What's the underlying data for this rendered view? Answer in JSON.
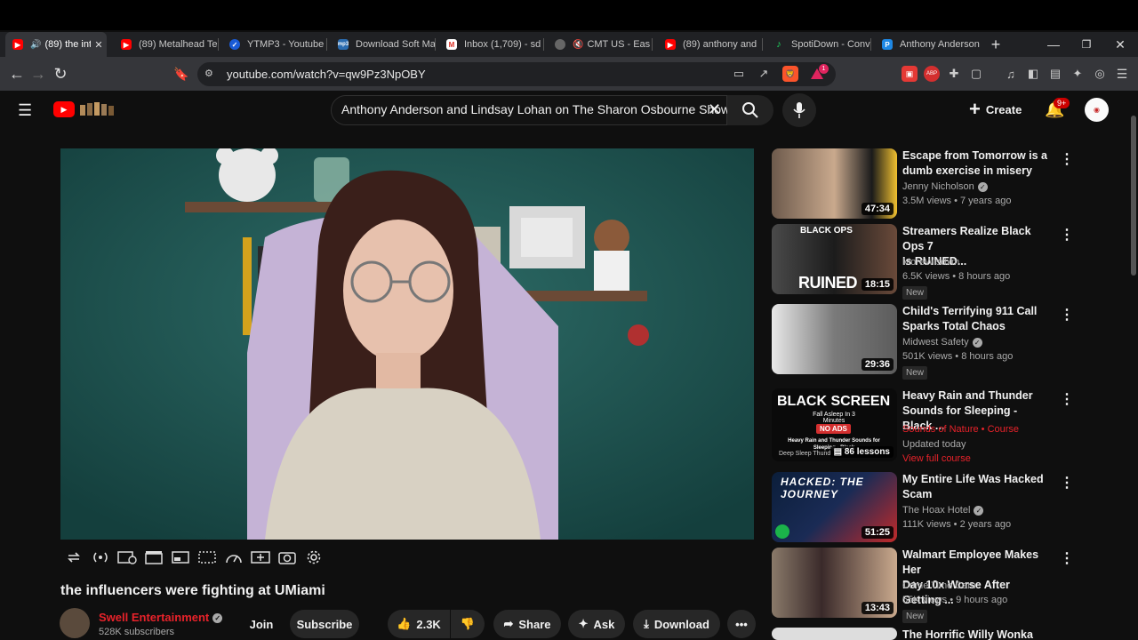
{
  "browser": {
    "tabs": [
      {
        "label": "(89) the int",
        "icon": "youtube-icon",
        "active": true
      },
      {
        "label": "(89) Metalhead Te",
        "icon": "youtube-icon"
      },
      {
        "label": "YTMP3 - Youtube",
        "icon": "ytmp3-icon"
      },
      {
        "label": "Download Soft Ma",
        "icon": "mp3-icon"
      },
      {
        "label": "Inbox (1,709) - sd",
        "icon": "gmail-icon"
      },
      {
        "label": "CMT US - Eas",
        "icon": "globe-icon"
      },
      {
        "label": "(89) anthony and",
        "icon": "youtube-icon"
      },
      {
        "label": "SpotiDown - Conv",
        "icon": "spotidown-icon"
      },
      {
        "label": "Anthony Anderson",
        "icon": "p-icon"
      }
    ],
    "url": "youtube.com/watch?v=qw9Pz3NpOBY",
    "brave_badge": "1"
  },
  "youtube": {
    "search_query": "Anthony Anderson and Lindsay Lohan on The Sharon Osbourne Show",
    "create_label": "Create",
    "notifications_count": "9+",
    "video_title": "the influencers were fighting at UMiami",
    "channel_name": "Swell Entertainment",
    "subscribers": "528K subscribers",
    "join_label": "Join",
    "subscribe_label": "Subscribe",
    "likes": "2.3K",
    "share_label": "Share",
    "ask_label": "Ask",
    "download_label": "Download",
    "colors": {
      "accent": "#ff0000",
      "channel": "#e8222a",
      "background": "#0f0f0f"
    }
  },
  "recommendations": [
    {
      "title_line1": "Escape from Tomorrow is a",
      "title_line2": "dumb exercise in misery",
      "channel": "Jenny Nicholson",
      "verified": true,
      "meta": "3.5M views • 7 years ago",
      "duration": "47:34",
      "badge": ""
    },
    {
      "title_line1": "Streamers Realize Black Ops 7",
      "title_line2": "Is RUINED...",
      "channel": "MoreWisdxm",
      "verified": false,
      "meta": "6.5K views • 8 hours ago",
      "duration": "18:15",
      "badge": "New",
      "thumb_text_top": "BLACK OPS",
      "thumb_text": "RUINED"
    },
    {
      "title_line1": "Child's Terrifying 911 Call",
      "title_line2": "Sparks Total Chaos",
      "channel": "Midwest Safety",
      "verified": true,
      "meta": "501K views • 8 hours ago",
      "duration": "29:36",
      "badge": "New"
    },
    {
      "title_line1": "Heavy Rain and Thunder",
      "title_line2": "Sounds for Sleeping - Black ...",
      "channel": "Sounds of Nature",
      "course": "Course",
      "meta": "Updated today",
      "duration": "86 lessons",
      "link": "View full course",
      "thumb_text": "BLACK SCREEN",
      "thumb_sub": "Fall Asleep In 3 Minutes",
      "thumb_noads": "NO ADS",
      "thumb_desc": "Heavy Rain and Thunder Sounds for Sleeping - Black",
      "thumb_bottom": "Deep Sleep Thund"
    },
    {
      "title_line1": "My Entire Life Was Hacked",
      "title_line2": "Scam",
      "channel": "The Hoax Hotel",
      "verified": true,
      "meta": "111K views • 2 years ago",
      "duration": "51:25",
      "badge": "",
      "thumb_text": "HACKED: THE JOURNEY"
    },
    {
      "title_line1": "Walmart Employee Makes Her",
      "title_line2": "Day 10x Worse After Getting ...",
      "channel": "Crime Time Cam",
      "verified": false,
      "meta": "55K views • 9 hours ago",
      "duration": "13:43",
      "badge": "New"
    },
    {
      "title_line1": "The Horrific Willy Wonka",
      "title_line2": "",
      "channel": "",
      "meta": "",
      "duration": "",
      "badge": ""
    }
  ]
}
